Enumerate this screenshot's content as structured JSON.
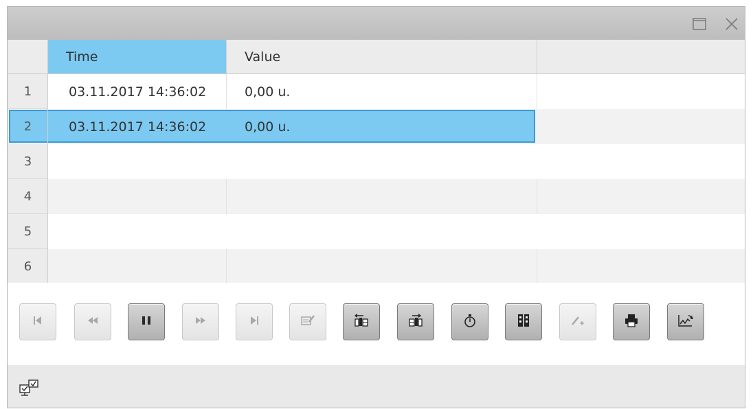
{
  "window": {
    "maximize_icon": "maximize-icon",
    "close_icon": "close-icon"
  },
  "table": {
    "columns": [
      "Time",
      "Value"
    ],
    "selected_column": "Time",
    "rows": [
      {
        "num": "1",
        "time": "03.11.2017 14:36:02",
        "value": "0,00 u."
      },
      {
        "num": "2",
        "time": "03.11.2017 14:36:02",
        "value": "0,00 u."
      },
      {
        "num": "3",
        "time": "",
        "value": ""
      },
      {
        "num": "4",
        "time": "",
        "value": ""
      },
      {
        "num": "5",
        "time": "",
        "value": ""
      },
      {
        "num": "6",
        "time": "",
        "value": ""
      }
    ],
    "selected_row": "2"
  },
  "toolbar": {
    "buttons": [
      {
        "icon": "first-record-icon",
        "enabled": false
      },
      {
        "icon": "fast-backward-icon",
        "enabled": false
      },
      {
        "icon": "pause-icon",
        "enabled": true
      },
      {
        "icon": "fast-forward-icon",
        "enabled": false
      },
      {
        "icon": "last-record-icon",
        "enabled": false
      },
      {
        "icon": "edit-table-icon",
        "enabled": false
      },
      {
        "icon": "import-column-icon",
        "enabled": true
      },
      {
        "icon": "export-column-icon",
        "enabled": true
      },
      {
        "icon": "stopwatch-icon",
        "enabled": true
      },
      {
        "icon": "column-select-icon",
        "enabled": true
      },
      {
        "icon": "add-pen-icon",
        "enabled": false
      },
      {
        "icon": "print-icon",
        "enabled": true
      },
      {
        "icon": "trend-chart-icon",
        "enabled": true
      }
    ]
  },
  "statusbar": {
    "icon": "connection-status-icon"
  },
  "colors": {
    "selection": "#7ccaf2",
    "selection_border": "#3a9bd6",
    "titlebar": "#c4c4c4"
  }
}
